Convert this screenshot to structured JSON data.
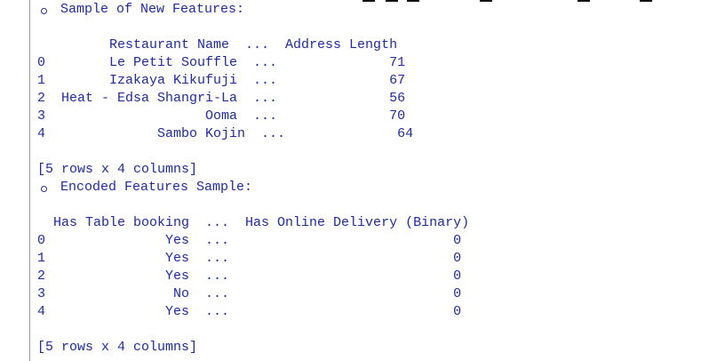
{
  "section1": {
    "title": "Sample of New Features:",
    "header": "         Restaurant Name  ...  Address Length",
    "rows": [
      "0        Le Petit Souffle  ...              71",
      "1        Izakaya Kikufuji  ...              67",
      "2  Heat - Edsa Shangri-La  ...              56",
      "3                    Ooma  ...              70",
      "4              Sambo Kojin  ...              64"
    ],
    "footer": "[5 rows x 4 columns]"
  },
  "section2": {
    "title": "Encoded Features Sample:",
    "header": "  Has Table booking  ...  Has Online Delivery (Binary)",
    "rows": [
      "0               Yes  ...                            0",
      "1               Yes  ...                            0",
      "2               Yes  ...                            0",
      "3                No  ...                            0",
      "4               Yes  ...                            0"
    ],
    "footer": "[5 rows x 4 columns]"
  }
}
